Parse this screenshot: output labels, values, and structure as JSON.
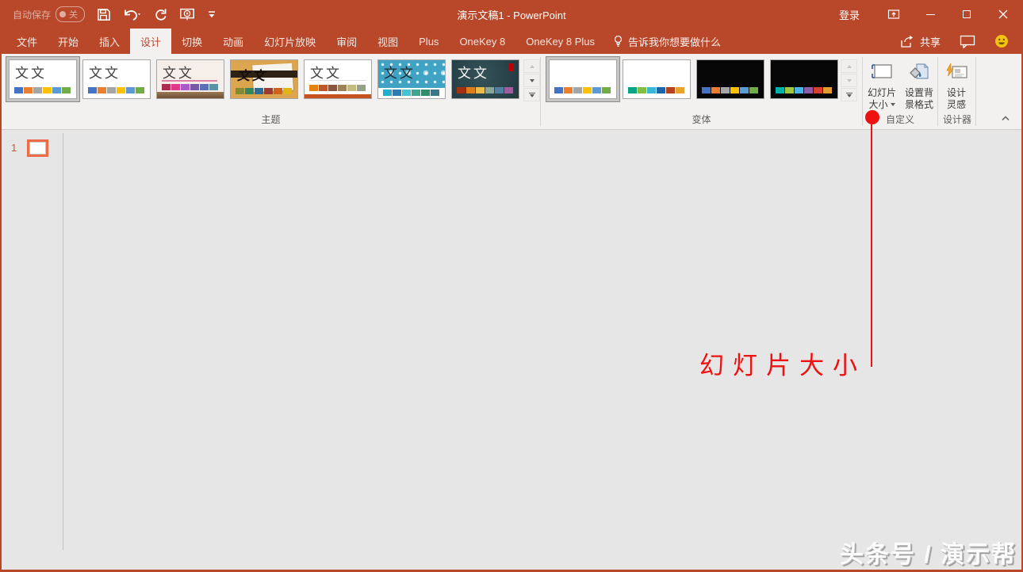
{
  "titlebar": {
    "autosave_label": "自动保存",
    "autosave_state": "关",
    "title": "演示文稿1 - PowerPoint",
    "signin": "登录"
  },
  "tabs": {
    "items": [
      {
        "label": "文件"
      },
      {
        "label": "开始"
      },
      {
        "label": "插入"
      },
      {
        "label": "设计",
        "active": true
      },
      {
        "label": "切换"
      },
      {
        "label": "动画"
      },
      {
        "label": "幻灯片放映"
      },
      {
        "label": "审阅"
      },
      {
        "label": "视图"
      },
      {
        "label": "Plus"
      },
      {
        "label": "OneKey 8"
      },
      {
        "label": "OneKey 8 Plus"
      }
    ],
    "tellme": "告诉我你想要做什么",
    "share": "共享"
  },
  "ribbon": {
    "themes": {
      "label": "主题",
      "items": [
        {
          "sample": "文文",
          "selected": true,
          "swatches": [
            "#4472C4",
            "#ED7D31",
            "#A5A5A5",
            "#FFC000",
            "#5B9BD5",
            "#70AD47"
          ]
        },
        {
          "sample": "文文",
          "swatches": [
            "#4472C4",
            "#ED7D31",
            "#A5A5A5",
            "#FFC000",
            "#5B9BD5",
            "#70AD47"
          ]
        },
        {
          "sample": "文文",
          "swatches": [
            "#AC2B50",
            "#E0398C",
            "#A95BC9",
            "#7559A5",
            "#5B6FB5",
            "#5795A5"
          ]
        },
        {
          "sample": "文文",
          "swatches": [
            "#7F8C34",
            "#34885C",
            "#2F6C95",
            "#9C3A33",
            "#D2611E",
            "#E0B514"
          ]
        },
        {
          "sample": "文文",
          "swatches": [
            "#E48312",
            "#BD582C",
            "#865640",
            "#9B8357",
            "#C2BC80",
            "#94A088"
          ]
        },
        {
          "sample": "文文",
          "swatches": [
            "#21ADCD",
            "#2D7BB5",
            "#42C3D6",
            "#3EA88F",
            "#2E8F6B",
            "#39788C"
          ]
        },
        {
          "sample": "文文",
          "swatches": [
            "#A5300F",
            "#DE7E18",
            "#E8BC4A",
            "#87A695",
            "#5080A0",
            "#9E5E9B"
          ]
        }
      ]
    },
    "variants": {
      "label": "变体",
      "items": [
        {
          "bg": "#FFFFFF",
          "selected": true,
          "swatches": [
            "#4472C4",
            "#ED7D31",
            "#A5A5A5",
            "#FFC000",
            "#5B9BD5",
            "#70AD47"
          ]
        },
        {
          "bg": "#FFFFFF",
          "swatches": [
            "#00A384",
            "#84BD41",
            "#38B7D6",
            "#1E64A6",
            "#B5411F",
            "#E8A32F"
          ]
        },
        {
          "bg": "#000000",
          "swatches": [
            "#4472C4",
            "#ED7D31",
            "#A5A5A5",
            "#FFC000",
            "#5B9BD5",
            "#70AD47"
          ]
        },
        {
          "bg": "#000000",
          "swatches": [
            "#00B2A9",
            "#A1C83C",
            "#4BB4E6",
            "#8E5BA6",
            "#D5412E",
            "#E39B32"
          ]
        }
      ]
    },
    "customize": {
      "label": "自定义",
      "slide_size": {
        "line1": "幻灯片",
        "line2": "大小"
      },
      "format_background": {
        "line1": "设置背",
        "line2": "景格式"
      }
    },
    "designer": {
      "label": "设计器",
      "design_ideas": {
        "line1": "设计",
        "line2": "灵感"
      }
    }
  },
  "slide_panel": {
    "slide_number": "1"
  },
  "annotation": {
    "text": "幻灯片大小",
    "color": "#EE1111"
  },
  "watermark": "头条号 / 演示帮",
  "colors": {
    "accent": "#B9472A",
    "selection_orange": "#ED6C47",
    "annotation_red": "#EE1111"
  }
}
